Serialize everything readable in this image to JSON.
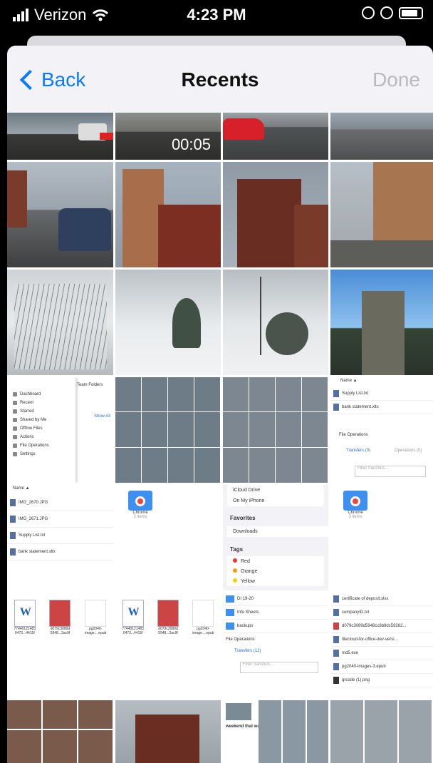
{
  "status_bar": {
    "carrier": "Verizon",
    "time": "4:23 PM"
  },
  "nav": {
    "back_label": "Back",
    "title": "Recents",
    "done_label": "Done"
  },
  "thumbnails": [
    {
      "name": "dashcam-road",
      "video_duration": ""
    },
    {
      "name": "video-red-car",
      "video_duration": "00:05"
    },
    {
      "name": "street-red-car",
      "video_duration": ""
    },
    {
      "name": "brick-street",
      "video_duration": ""
    }
  ],
  "embedded": {
    "sidebar_items": [
      "Dashboard",
      "Recent",
      "Starred",
      "Shared by Me",
      "Offline Files",
      "Actions",
      "File Operations",
      "Settings"
    ],
    "team_folders": "Team Folders",
    "show_all": "Show All",
    "name_header": "Name ▲",
    "files_left": [
      {
        "name": "IMG_2670.JPG",
        "meta": "1.55 MB 17-01-2023 2:23 AM"
      },
      {
        "name": "IMG_2671.JPG",
        "meta": "1.3 MB 17-01-2023 2:23 AM"
      },
      {
        "name": "Supply List.txt",
        "meta": "65 B 23-10-2022 10:49 PM"
      },
      {
        "name": "bank statement.xltx",
        "meta": "34 KB 28-03-2022 10:40 PM"
      }
    ],
    "files_right": [
      {
        "name": "Supply List.txt",
        "meta": "65 B 23-10-2022 10:49 PM"
      },
      {
        "name": "bank statement.xltx",
        "meta": "34 KB 28-03-2022 10:40 PM"
      }
    ],
    "file_ops": "File Operations",
    "transfers_tab": "Transfers (0)",
    "operations_tab": "Operations (0)",
    "filter_placeholder": "Filter transfers...",
    "chrome_folder": {
      "label": "Chrome",
      "meta": "3 items"
    },
    "locations": [
      "iCloud Drive",
      "On My iPhone"
    ],
    "favorites_header": "Favorites",
    "downloads": "Downloads",
    "tags_header": "Tags",
    "tags": [
      "Red",
      "Orange",
      "Yellow"
    ],
    "docs": [
      {
        "name": "77440121483 0473...4415f",
        "date": "8/31/22",
        "size": "228 KB"
      },
      {
        "name": "d079c3089d 5948...2ac9f",
        "date": "6/8/23",
        "size": "870 KB"
      },
      {
        "name": "pg2040- image....epub",
        "date": "6/8/23",
        "size": "173 KB"
      }
    ],
    "folders_bottom": [
      "DI 19-20",
      "Info Sheets",
      "backups"
    ],
    "transfers_12": "Transfers (12)",
    "files_bottom_right": [
      "certificate of deposit.xlsx",
      "companyID.txt",
      "d079c3089d5948cc8b9dc59282...",
      "filecloud-for-office-dev-versi...",
      "md5.exe",
      "pg2040-images-3.epub",
      "qrcode (1).png"
    ],
    "article_title": "weekend that was"
  }
}
